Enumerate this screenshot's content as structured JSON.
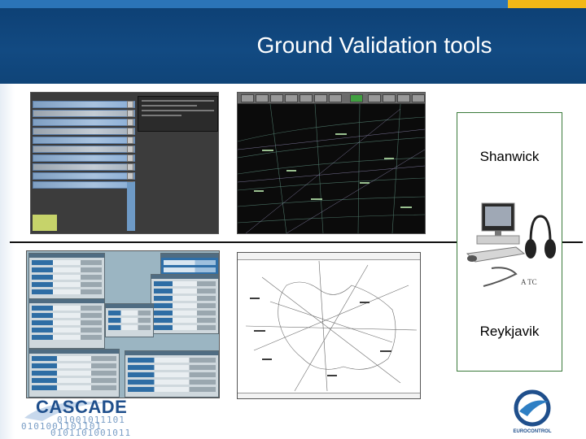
{
  "slide": {
    "title": "Ground Validation tools"
  },
  "atc_box": {
    "top_label": "Shanwick",
    "image_caption": "A TC",
    "bottom_label": "Reykjavik"
  },
  "logos": {
    "left": "CASCADE",
    "left_bits_row1": "01001011101",
    "left_bits_row2": "0101001101101",
    "left_bits_row3": "0101101001011",
    "right": "EUROCONTROL"
  },
  "colors": {
    "header_blue": "#124a82",
    "header_accent": "#f2b817",
    "box_border": "#3a7a3a"
  }
}
